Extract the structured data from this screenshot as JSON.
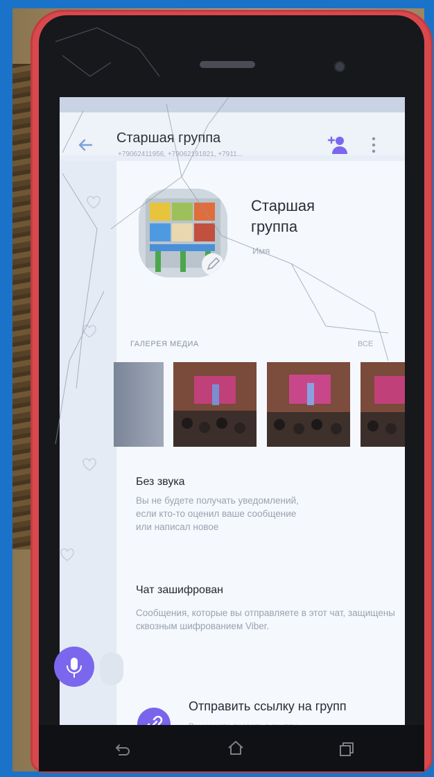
{
  "header": {
    "title": "Старшая группа",
    "subtitle": "+79062411956, +79062191821, +7911..."
  },
  "profile": {
    "name": "Старшая группа",
    "caption": "Имя"
  },
  "gallery": {
    "header": "ГАЛЕРЕЯ МЕДИА",
    "all_link": "ВСЕ"
  },
  "mute": {
    "title": "Без звука",
    "text": "Вы не будете получать уведомлений, если кто-то оценил ваше сообщение или написал новое"
  },
  "encryption": {
    "title": "Чат зашифрован",
    "text": "Сообщения, которые вы отправляете в этот чат, защищены сквозным шифрованием Viber."
  },
  "share_link": {
    "title": "Отправить ссылку на групп",
    "subtitle": "Вы можете позвать в группу"
  },
  "icons": {
    "back": "back-arrow-icon",
    "add_member": "add-member-icon",
    "menu": "more-vert-icon",
    "mic": "microphone-icon",
    "link": "link-icon",
    "nav_back": "nav-back-icon",
    "nav_home": "nav-home-icon",
    "nav_recent": "nav-recent-icon"
  },
  "colors": {
    "accent": "#7b67ee",
    "case": "#d8494e",
    "frame": "#1a73c8"
  }
}
